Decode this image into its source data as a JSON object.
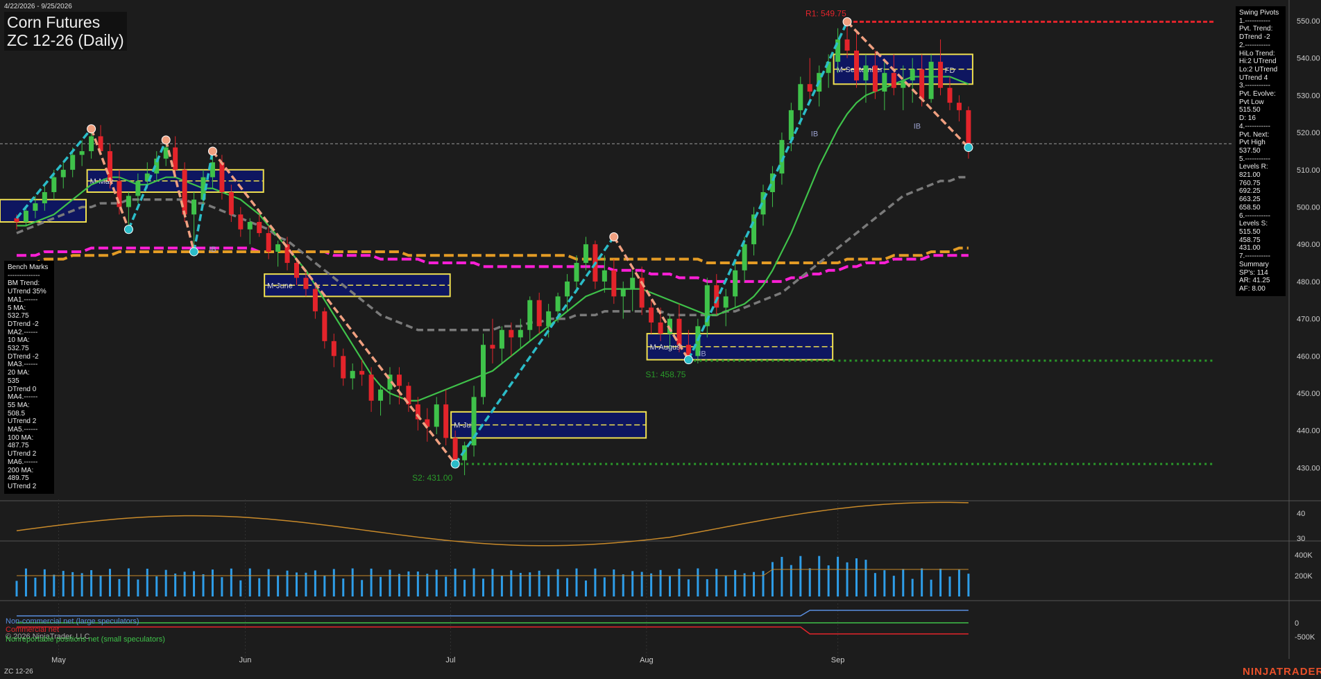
{
  "header": {
    "date_range": "4/22/2026 - 9/25/2026",
    "title_line1": "Corn Futures",
    "title_line2": "ZC 12-26 (Daily)"
  },
  "colors": {
    "background": "#1c1c1c",
    "up_candle": "#3fc24a",
    "down_candle": "#e3242b",
    "ma20": "#3fc24a",
    "ma55": "#7a7a7a",
    "ma100": "#e39b25",
    "ma200": "#ff1fd6",
    "swing_up": "#2bbcc8",
    "swing_down": "#f0a080",
    "resistance": "#e3242b",
    "support": "#2a9a2a",
    "brand": "#e8502a"
  },
  "bench_marks": {
    "title": "Bench Marks",
    "sep": "--------------",
    "lines": [
      "BM Trend:",
      "UTrend 35%",
      "MA1.------",
      "5 MA:",
      "532.75",
      "DTrend -2",
      "MA2.------",
      "10 MA:",
      "532.75",
      "DTrend -2",
      "MA3.------",
      "20 MA:",
      "535",
      "DTrend 0",
      "MA4.------",
      "55 MA:",
      "508.5",
      "UTrend 2",
      "MA5.------",
      "100 MA:",
      "487.75",
      "UTrend 2",
      "MA6.------",
      "200 MA:",
      "489.75",
      "UTrend 2"
    ]
  },
  "swing_pivots": {
    "title": "Swing Pivots",
    "lines": [
      "1.-----------",
      "Pvt. Trend:",
      "DTrend -2",
      "2.-----------",
      "HiLo Trend:",
      "Hi:2 UTrend",
      "Lo:2 UTrend",
      "UTrend 4",
      "3.-----------",
      "Pvt. Evolve:",
      "Pvt Low",
      "515.50",
      "D: 16",
      "4.-----------",
      "Pvt. Next:",
      "Pvt High",
      "537.50",
      "5.-----------",
      "Levels R:",
      "821.00",
      "760.75",
      "692.25",
      "663.25",
      "658.50",
      "6.-----------",
      "Levels S:",
      "515.50",
      "458.75",
      "431.00",
      "7.-----------",
      "Summary",
      "SP's: 114",
      "AR: 41.25",
      "AF: 8.00"
    ]
  },
  "annotations": {
    "r1": "R1: 549.75",
    "s1": "S1: 458.75",
    "s2": "S2: 431.00",
    "ib_labels": [
      "IB",
      "IB",
      "IB",
      "IB"
    ],
    "fd_label": "FD"
  },
  "cot_legend": {
    "noncommercial": "Non-commercial net (large speculators)",
    "commercial": "Commercial net",
    "nonreportable": "Nonreportable positions net (small speculators)",
    "copyright": "© 2026 NinjaTrader, LLC"
  },
  "footer": {
    "symbol": "ZC 12-26",
    "brand": "NINJATRADER"
  },
  "chart_data": {
    "type": "candlestick",
    "price_axis_ticks": [
      550,
      540,
      530,
      520,
      510,
      500,
      490,
      480,
      470,
      460,
      450,
      440,
      430
    ],
    "ylim": [
      425,
      553
    ],
    "x_axis_labels": [
      "May",
      "Jun",
      "Jul",
      "Aug",
      "Sep"
    ],
    "candles": [
      [
        497,
        498,
        494,
        496
      ],
      [
        496,
        500,
        495,
        499
      ],
      [
        499,
        503,
        497,
        501
      ],
      [
        501,
        506,
        499,
        504
      ],
      [
        504,
        510,
        502,
        508
      ],
      [
        508,
        512,
        505,
        510
      ],
      [
        510,
        516,
        508,
        514
      ],
      [
        514,
        518,
        511,
        515
      ],
      [
        515,
        521,
        513,
        519
      ],
      [
        519,
        522,
        514,
        515
      ],
      [
        515,
        517,
        505,
        507
      ],
      [
        507,
        510,
        498,
        500
      ],
      [
        500,
        504,
        495,
        503
      ],
      [
        503,
        509,
        501,
        507
      ],
      [
        507,
        512,
        505,
        509
      ],
      [
        509,
        515,
        507,
        513
      ],
      [
        513,
        518,
        511,
        516
      ],
      [
        516,
        519,
        508,
        510
      ],
      [
        510,
        512,
        496,
        498
      ],
      [
        498,
        504,
        488,
        502
      ],
      [
        502,
        510,
        500,
        508
      ],
      [
        508,
        515,
        505,
        512
      ],
      [
        512,
        514,
        502,
        504
      ],
      [
        504,
        506,
        496,
        498
      ],
      [
        498,
        500,
        492,
        494
      ],
      [
        494,
        497,
        490,
        496
      ],
      [
        496,
        498,
        492,
        493
      ],
      [
        493,
        495,
        486,
        488
      ],
      [
        488,
        491,
        484,
        490
      ],
      [
        490,
        492,
        483,
        485
      ],
      [
        485,
        486,
        479,
        481
      ],
      [
        481,
        483,
        476,
        478
      ],
      [
        478,
        479,
        470,
        472
      ],
      [
        472,
        473,
        462,
        464
      ],
      [
        464,
        466,
        457,
        460
      ],
      [
        460,
        462,
        452,
        454
      ],
      [
        454,
        458,
        451,
        456
      ],
      [
        456,
        459,
        452,
        455
      ],
      [
        455,
        457,
        445,
        448
      ],
      [
        448,
        452,
        444,
        451
      ],
      [
        451,
        457,
        447,
        455
      ],
      [
        455,
        457,
        447,
        452
      ],
      [
        452,
        453,
        445,
        447
      ],
      [
        447,
        449,
        440,
        443
      ],
      [
        443,
        446,
        437,
        441
      ],
      [
        441,
        449,
        439,
        447
      ],
      [
        447,
        451,
        436,
        438
      ],
      [
        438,
        440,
        430,
        432
      ],
      [
        432,
        437,
        428,
        436
      ],
      [
        436,
        452,
        433,
        449
      ],
      [
        449,
        466,
        447,
        463
      ],
      [
        463,
        470,
        458,
        462
      ],
      [
        462,
        468,
        458,
        467
      ],
      [
        467,
        469,
        460,
        465
      ],
      [
        465,
        470,
        462,
        467
      ],
      [
        467,
        476,
        464,
        475
      ],
      [
        475,
        477,
        466,
        468
      ],
      [
        468,
        474,
        465,
        472
      ],
      [
        472,
        477,
        469,
        476
      ],
      [
        476,
        482,
        472,
        480
      ],
      [
        480,
        487,
        477,
        485
      ],
      [
        485,
        492,
        483,
        490
      ],
      [
        490,
        491,
        478,
        480
      ],
      [
        480,
        487,
        477,
        483
      ],
      [
        483,
        486,
        474,
        476
      ],
      [
        476,
        480,
        470,
        478
      ],
      [
        478,
        483,
        472,
        481
      ],
      [
        481,
        484,
        471,
        473
      ],
      [
        473,
        475,
        466,
        469
      ],
      [
        469,
        473,
        464,
        466
      ],
      [
        466,
        471,
        462,
        470
      ],
      [
        470,
        474,
        461,
        463
      ],
      [
        463,
        467,
        458,
        460
      ],
      [
        460,
        470,
        458,
        468
      ],
      [
        468,
        481,
        465,
        479
      ],
      [
        479,
        482,
        471,
        473
      ],
      [
        473,
        478,
        468,
        476
      ],
      [
        476,
        485,
        473,
        483
      ],
      [
        483,
        492,
        480,
        490
      ],
      [
        490,
        500,
        487,
        498
      ],
      [
        498,
        506,
        495,
        504
      ],
      [
        504,
        511,
        500,
        509
      ],
      [
        509,
        520,
        506,
        518
      ],
      [
        518,
        528,
        515,
        526
      ],
      [
        526,
        535,
        522,
        533
      ],
      [
        533,
        540,
        528,
        531
      ],
      [
        531,
        538,
        527,
        536
      ],
      [
        536,
        541,
        532,
        539
      ],
      [
        539,
        548,
        536,
        545
      ],
      [
        545,
        550,
        540,
        542
      ],
      [
        542,
        547,
        532,
        534
      ],
      [
        534,
        541,
        528,
        538
      ],
      [
        538,
        542,
        529,
        531
      ],
      [
        531,
        539,
        526,
        536
      ],
      [
        536,
        541,
        530,
        532
      ],
      [
        532,
        538,
        526,
        534
      ],
      [
        534,
        540,
        528,
        537
      ],
      [
        537,
        541,
        527,
        529
      ],
      [
        529,
        541,
        528,
        539
      ],
      [
        539,
        545,
        530,
        532
      ],
      [
        532,
        535,
        526,
        528
      ],
      [
        528,
        530,
        523,
        526
      ],
      [
        526,
        527,
        513,
        516
      ]
    ],
    "ma20": [
      495,
      495,
      496,
      497,
      498,
      500,
      502,
      504,
      506,
      507,
      508,
      508,
      507,
      506,
      506,
      507,
      508,
      508,
      507,
      506,
      505,
      505,
      504,
      503,
      502,
      500,
      498,
      495,
      492,
      489,
      486,
      483,
      479,
      475,
      471,
      467,
      463,
      459,
      455,
      452,
      450,
      449,
      448,
      448,
      449,
      450,
      451,
      452,
      453,
      454,
      455,
      456,
      458,
      460,
      462,
      464,
      466,
      468,
      470,
      472,
      474,
      476,
      477,
      478,
      478,
      478,
      478,
      478,
      477,
      476,
      475,
      474,
      473,
      472,
      471,
      471,
      472,
      473,
      474,
      476,
      479,
      483,
      488,
      493,
      499,
      505,
      511,
      516,
      521,
      525,
      528,
      530,
      531,
      532,
      533,
      534,
      535,
      535,
      535,
      535,
      535,
      534,
      533
    ],
    "ma55": [
      493,
      494,
      495,
      496,
      497,
      498,
      499,
      500,
      500,
      501,
      501,
      501,
      502,
      502,
      502,
      502,
      502,
      502,
      502,
      501,
      501,
      500,
      499,
      498,
      497,
      496,
      495,
      494,
      492,
      491,
      489,
      487,
      485,
      483,
      481,
      479,
      477,
      475,
      473,
      471,
      470,
      469,
      468,
      467,
      467,
      467,
      467,
      467,
      467,
      467,
      467,
      467,
      468,
      468,
      468,
      469,
      469,
      470,
      470,
      470,
      471,
      471,
      471,
      472,
      472,
      472,
      472,
      472,
      472,
      472,
      471,
      471,
      471,
      471,
      471,
      471,
      472,
      472,
      473,
      474,
      475,
      476,
      477,
      479,
      481,
      483,
      485,
      487,
      489,
      491,
      493,
      495,
      497,
      499,
      501,
      503,
      504,
      505,
      506,
      507,
      507,
      508,
      508
    ],
    "ma100": [
      485,
      485,
      485,
      486,
      486,
      486,
      487,
      487,
      487,
      487,
      487,
      488,
      488,
      488,
      488,
      488,
      488,
      488,
      488,
      488,
      488,
      488,
      488,
      488,
      488,
      488,
      488,
      488,
      488,
      488,
      488,
      488,
      488,
      488,
      488,
      488,
      488,
      488,
      488,
      488,
      488,
      488,
      487,
      487,
      487,
      487,
      487,
      487,
      487,
      487,
      487,
      487,
      487,
      487,
      487,
      487,
      487,
      487,
      487,
      487,
      486,
      486,
      486,
      486,
      486,
      486,
      486,
      486,
      486,
      486,
      486,
      486,
      486,
      486,
      485,
      485,
      485,
      485,
      485,
      485,
      485,
      485,
      485,
      485,
      485,
      485,
      485,
      485,
      485,
      486,
      486,
      486,
      486,
      486,
      487,
      487,
      487,
      487,
      488,
      488,
      488,
      489,
      489
    ],
    "ma200": [
      487,
      487,
      487,
      488,
      488,
      488,
      488,
      488,
      489,
      489,
      489,
      489,
      489,
      489,
      489,
      489,
      489,
      489,
      489,
      489,
      489,
      489,
      489,
      489,
      489,
      489,
      488,
      488,
      488,
      488,
      488,
      488,
      488,
      488,
      487,
      487,
      487,
      487,
      487,
      486,
      486,
      486,
      486,
      486,
      485,
      485,
      485,
      485,
      485,
      485,
      484,
      484,
      484,
      484,
      484,
      484,
      484,
      484,
      484,
      484,
      484,
      484,
      484,
      484,
      483,
      483,
      483,
      483,
      482,
      482,
      482,
      481,
      481,
      481,
      480,
      480,
      480,
      480,
      480,
      480,
      480,
      480,
      480,
      481,
      481,
      482,
      482,
      483,
      483,
      484,
      484,
      485,
      485,
      485,
      486,
      486,
      486,
      486,
      487,
      487,
      487,
      487,
      487
    ],
    "swing_lines": [
      {
        "dir": "up",
        "from": [
          0,
          497
        ],
        "to": [
          8,
          521
        ]
      },
      {
        "dir": "down",
        "from": [
          8,
          521
        ],
        "to": [
          12,
          494
        ]
      },
      {
        "dir": "up",
        "from": [
          12,
          494
        ],
        "to": [
          16,
          518
        ]
      },
      {
        "dir": "down",
        "from": [
          16,
          518
        ],
        "to": [
          19,
          488
        ]
      },
      {
        "dir": "up",
        "from": [
          19,
          488
        ],
        "to": [
          21,
          515
        ]
      },
      {
        "dir": "down",
        "from": [
          21,
          515
        ],
        "to": [
          47,
          431
        ]
      },
      {
        "dir": "up",
        "from": [
          47,
          431
        ],
        "to": [
          64,
          492
        ]
      },
      {
        "dir": "down",
        "from": [
          64,
          492
        ],
        "to": [
          72,
          459
        ]
      },
      {
        "dir": "up",
        "from": [
          72,
          459
        ],
        "to": [
          89,
          549.75
        ]
      },
      {
        "dir": "down",
        "from": [
          89,
          549.75
        ],
        "to": [
          102,
          516
        ]
      }
    ],
    "resistance_level": 549.75,
    "support_levels": [
      458.75,
      431.0
    ],
    "monthly_boxes": [
      {
        "label": "M-May",
        "x0": 8,
        "x1": 26,
        "y0": 504,
        "y1": 510
      },
      {
        "label": "M-June",
        "x0": 27,
        "x1": 46,
        "y0": 476,
        "y1": 482
      },
      {
        "label": "M-July",
        "x0": 47,
        "x1": 67,
        "y0": 438,
        "y1": 445
      },
      {
        "label": "M-August",
        "x0": 68,
        "x1": 87,
        "y0": 459,
        "y1": 466
      },
      {
        "label": "M-September",
        "x0": 88,
        "x1": 102,
        "y0": 533,
        "y1": 541
      }
    ],
    "indicator_panel_ticks": [
      40,
      30
    ],
    "volume_ticks": [
      "400K",
      "200K"
    ],
    "cot_ticks": [
      "0",
      "-500K"
    ]
  }
}
